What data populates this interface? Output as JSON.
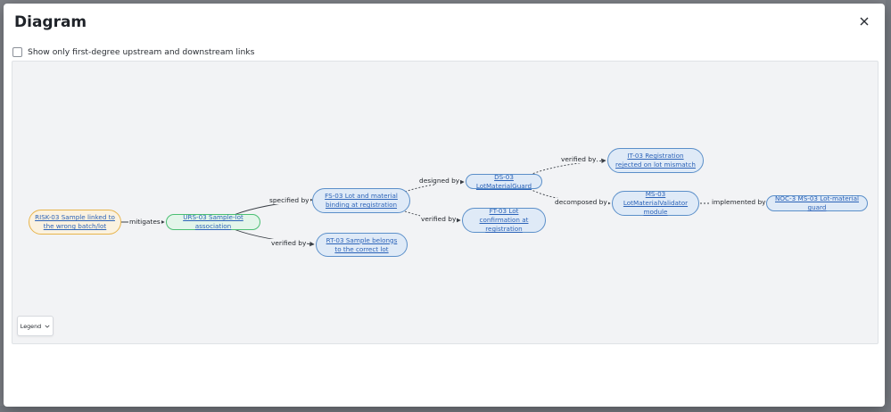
{
  "dialog": {
    "title": "Diagram",
    "checkbox_label": "Show only first-degree upstream and downstream links",
    "checkbox_checked": false,
    "legend_label": "Legend"
  },
  "colors": {
    "risk_fill": "#fbf2e0",
    "risk_border": "#e7b44c",
    "urs_fill": "#e3f5ea",
    "urs_border": "#4bbf73",
    "node_fill": "#dfeaf7",
    "node_border": "#5b8fc9",
    "link_text": "#2c63b8"
  },
  "nodes": [
    {
      "id": "risk03",
      "type": "risk",
      "label": "RISK-03 Sample linked to the wrong batch/lot"
    },
    {
      "id": "urs03",
      "type": "urs",
      "label": "URS-03 Sample-lot association"
    },
    {
      "id": "fs03",
      "type": "spec",
      "label": "FS-03 Lot and material binding at registration"
    },
    {
      "id": "rt03",
      "type": "spec",
      "label": "RT-03 Sample belongs to the correct lot"
    },
    {
      "id": "ds03",
      "type": "spec",
      "label": "DS-03 LotMaterialGuard"
    },
    {
      "id": "ft03",
      "type": "spec",
      "label": "FT-03 Lot confirmation at registration"
    },
    {
      "id": "it03",
      "type": "spec",
      "label": "IT-03 Registration rejected on lot mismatch"
    },
    {
      "id": "ms03",
      "type": "spec",
      "label": "MS-03 LotMaterialValidator module"
    },
    {
      "id": "noc3",
      "type": "spec",
      "label": "NOC-3 MS-03 Lot-material guard"
    }
  ],
  "edges": [
    {
      "id": "e1",
      "from": "risk03",
      "to": "urs03",
      "label": "mitigates"
    },
    {
      "id": "e2",
      "from": "urs03",
      "to": "fs03",
      "label": "specified by"
    },
    {
      "id": "e3",
      "from": "urs03",
      "to": "rt03",
      "label": "verified by"
    },
    {
      "id": "e4",
      "from": "fs03",
      "to": "ds03",
      "label": "designed by"
    },
    {
      "id": "e5",
      "from": "fs03",
      "to": "ft03",
      "label": "verified by"
    },
    {
      "id": "e6",
      "from": "ds03",
      "to": "it03",
      "label": "verified by"
    },
    {
      "id": "e7",
      "from": "ds03",
      "to": "ms03",
      "label": "decomposed by"
    },
    {
      "id": "e8",
      "from": "ms03",
      "to": "noc3",
      "label": "implemented by"
    }
  ]
}
